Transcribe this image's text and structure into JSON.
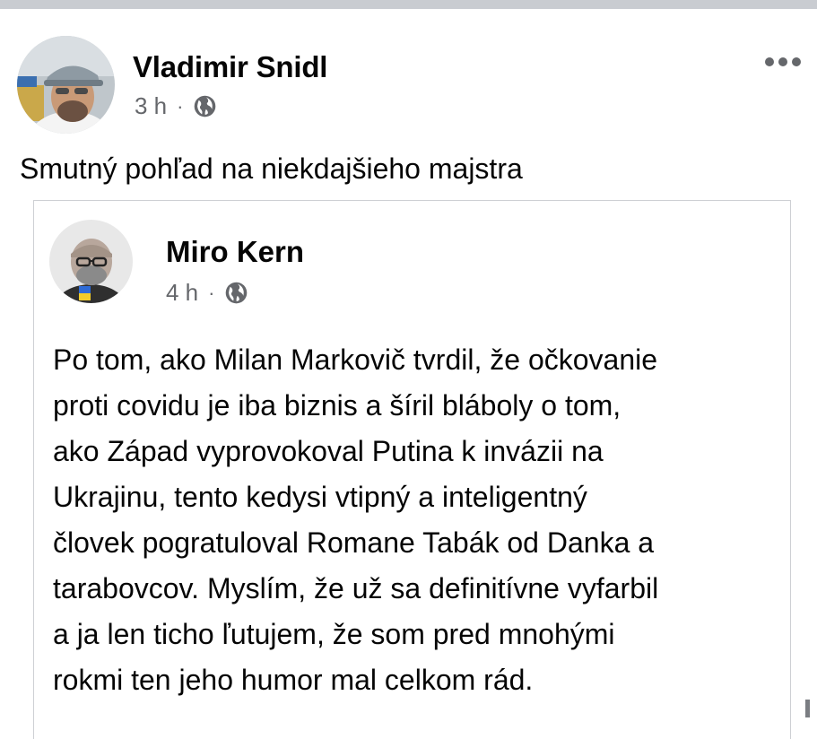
{
  "post": {
    "author": "Vladimir Snidl",
    "time": "3 h",
    "separator": "·",
    "audience_icon": "globe-icon",
    "more_icon": "more-horizontal-icon",
    "text": "Smutný pohľad na niekdajšieho majstra"
  },
  "shared_post": {
    "author": "Miro Kern",
    "time": "4 h",
    "separator": "·",
    "audience_icon": "globe-icon",
    "lines": [
      "Po tom, ako Milan Markovič tvrdil, že očkovanie",
      "proti covidu je iba biznis a šíril bláboly o tom,",
      "ako Západ vyprovokoval Putina k invázii na",
      "Ukrajinu, tento kedysi vtipný a inteligentný",
      "človek pogratuloval Romane Tabák od Danka a",
      "tarabovcov. Myslím, že už sa definitívne vyfarbil",
      "a ja len ticho ľutujem, že som pred mnohými",
      "rokmi ten jeho humor mal celkom rád."
    ]
  },
  "colors": {
    "text_primary": "#050505",
    "text_secondary": "#65676b",
    "card_border": "#ced0d4",
    "top_strip": "#c9ccd1"
  }
}
